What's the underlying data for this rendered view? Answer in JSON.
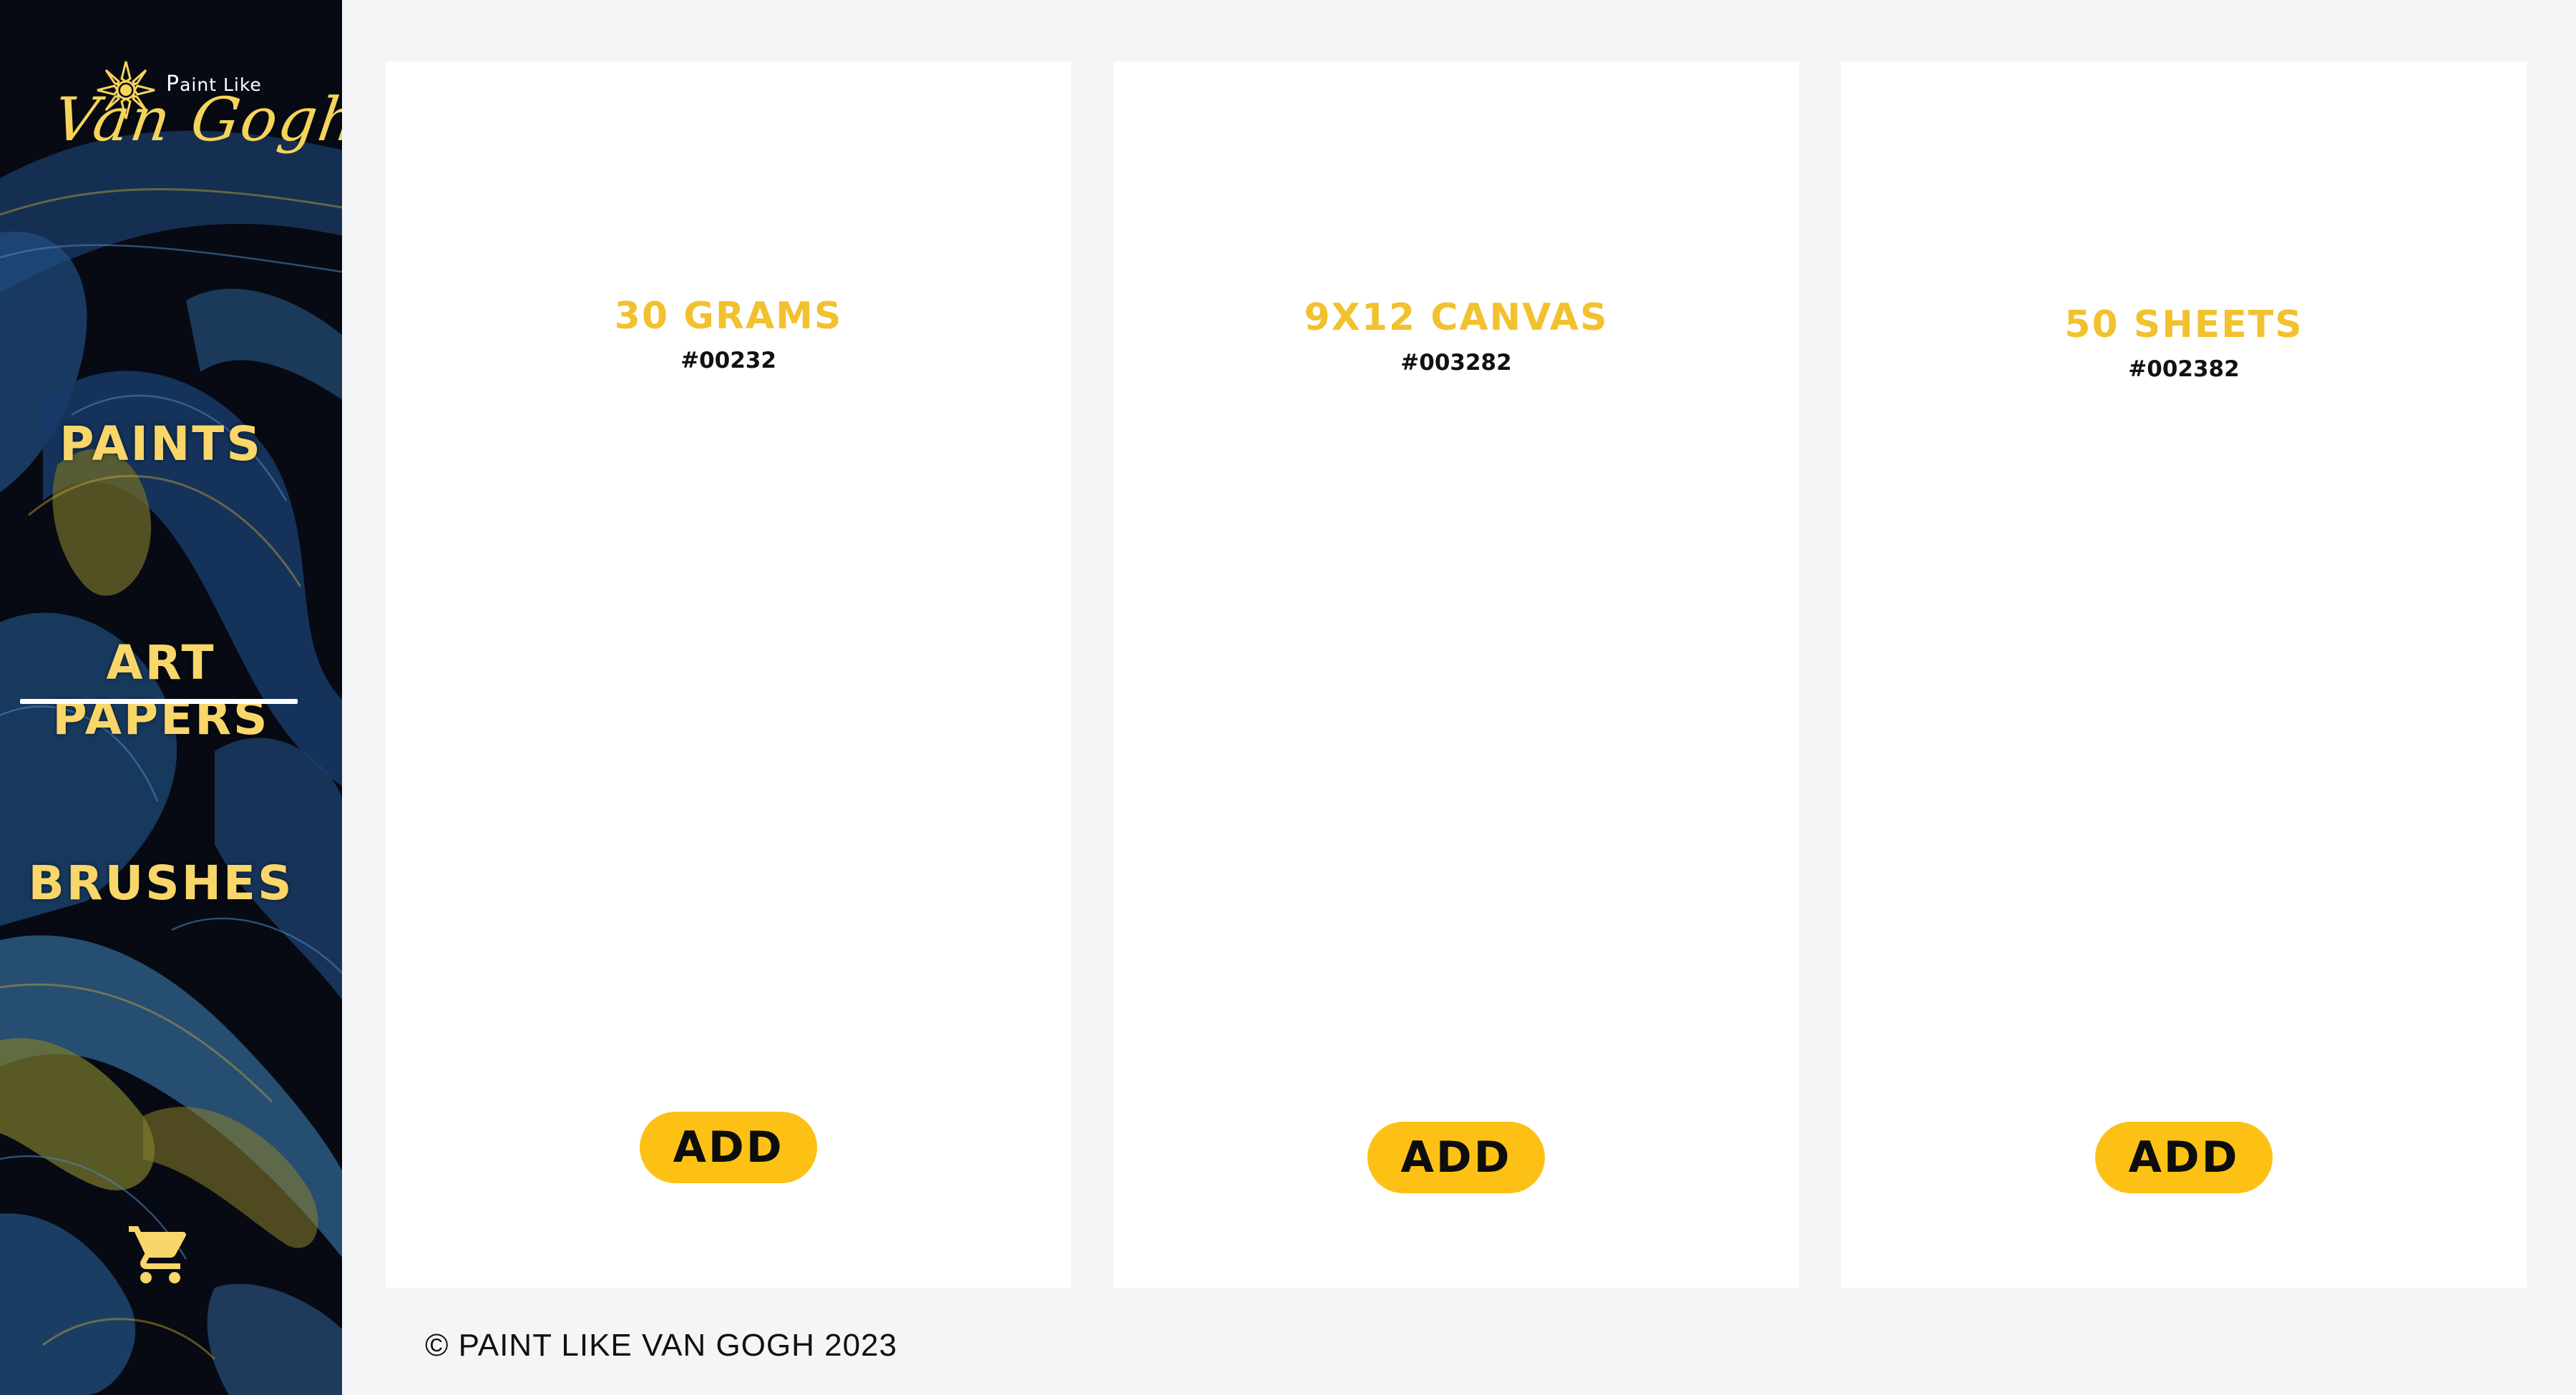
{
  "sidebar": {
    "logo": {
      "small_text": "Paint Like",
      "script_text": "Van Gogh"
    },
    "nav": [
      {
        "label": "PAINTS"
      },
      {
        "label": "ART PAPERS",
        "active": true
      },
      {
        "label": "BRUSHES"
      }
    ],
    "cart_icon": "shopping-cart-icon"
  },
  "products": [
    {
      "title": "30 GRAMS",
      "code": "#00232",
      "button": "ADD"
    },
    {
      "title": "9X12 CANVAS",
      "code": "#003282",
      "button": "ADD"
    },
    {
      "title": "50 SHEETS",
      "code": "#002382",
      "button": "ADD"
    }
  ],
  "footer": {
    "text": "© PAINT LIKE VAN GOGH 2023"
  },
  "colors": {
    "accent_yellow": "#fdc116",
    "title_yellow": "#f2c12e",
    "nav_yellow": "#f8d66a",
    "sidebar_bg": "#070a12",
    "page_bg": "#f4f5f7"
  }
}
